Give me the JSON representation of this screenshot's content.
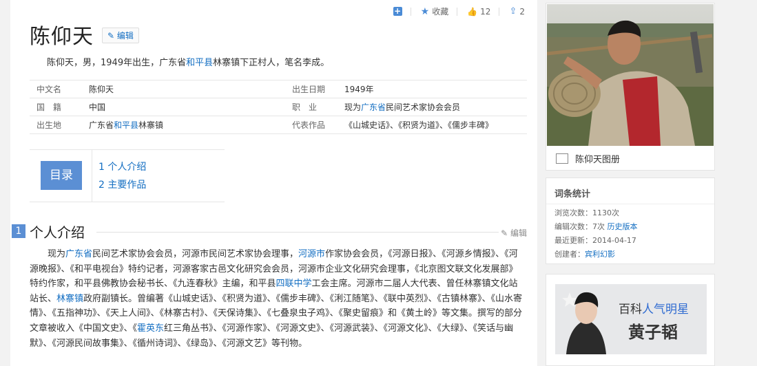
{
  "actions": {
    "collect": "收藏",
    "like_count": "12",
    "share_count": "2"
  },
  "title": "陈仰天",
  "edit_label": "编辑",
  "summary": {
    "pre": "陈仰天，男，1949年出生，广东省",
    "link": "和平县",
    "post": "林寨镇下正村人，笔名李成。"
  },
  "info": {
    "rows": [
      {
        "k1": "中文名",
        "v1": "陈仰天",
        "k2": "出生日期",
        "v2": "1949年"
      },
      {
        "k1": "国　籍",
        "v1": "中国",
        "k2": "职　业"
      },
      {
        "k1": "出生地",
        "k2": "代表作品",
        "v2": "《山城史话》、《积贤为道》、《儒步丰碑》"
      }
    ],
    "job": {
      "pre": "现为",
      "link": "广东省",
      "post": "民间艺术家协会会员"
    },
    "birthplace": {
      "pre": "广东省",
      "link": "和平县",
      "post": "林寨镇"
    }
  },
  "catalog": {
    "label": "目录",
    "items": [
      "1  个人介绍",
      "2  主要作品"
    ]
  },
  "section1": {
    "num": "1",
    "title": "个人介绍",
    "edit": "编辑"
  },
  "para": {
    "p1": "现为",
    "l1": "广东省",
    "p2": "民间艺术家协会会员，河源市民间艺术家协会理事，",
    "l2": "河源市",
    "p3": "作家协会会员，《河源日报》、《河源乡情报》、《河源晚报》、《和平电视台》特约记者，河源客家古邑文化研究会会员，河源市企业文化研究会理事，《北京图文联文化发展部》特约作家，和平县佛教协会秘书长、《九连春秋》主编，和平县",
    "l3": "四联中学",
    "p4": "工会主席。河源市二届人大代表、曾任林寨镇文化站站长、",
    "l4": "林寨镇",
    "p5": "政府副镇长。曾编著《山城史话》、《积贤为道》、《儒步丰碑》、《浰江随笔》、《联中英烈》、《古镇林寨》、《山水寄情》、《五指神功》、《天上人间》、《林寨古村》、《天保诗集》、《七叠泉虫子鸡》、《聚史留痕》和《黄土岭》等文集。撰写的部分文章被收入《中国文史》、《",
    "l5": "霍英东",
    "p6": "红三角丛书》、《河源作家》、《河源文史》、《河源武装》、《河源文化》、《大绿》、《笑话与幽默》、《河源民间故事集》、《循州诗词》、《绿岛》、《河源文艺》等刊物。"
  },
  "sidebar": {
    "album_label": "陈仰天图册",
    "stats": {
      "title": "词条统计",
      "views_label": "浏览次数：",
      "views": "1130次",
      "edits_label": "编辑次数：",
      "edits": "7次",
      "history": "历史版本",
      "updated_label": "最近更新：",
      "updated": "2014-04-17",
      "creator_label": "创建者：",
      "creator": "宾利幻影"
    },
    "promo": {
      "line1_pre": "百科",
      "line1_blue": "人气明星",
      "line2": "黄子韬"
    }
  },
  "colors": {
    "link": "#136ec2",
    "accent": "#5b8fd4"
  }
}
